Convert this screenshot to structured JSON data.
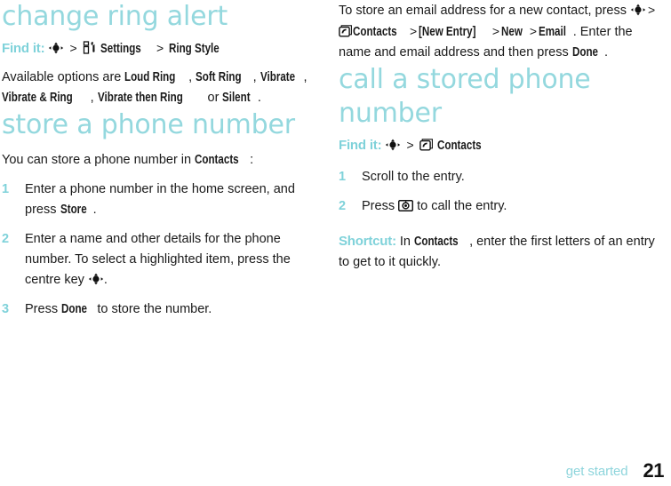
{
  "document": {
    "footer_section": "get started",
    "page_number": "21"
  },
  "colors": {
    "heading_teal": "#94d8de",
    "accent_teal": "#7fd2da",
    "body_text": "#1a1a1a"
  },
  "left_column": {
    "section1": {
      "title": "change ring alert",
      "findit_label": "Find it:",
      "findit_path": [
        {
          "type": "icon",
          "name": "centre-key-icon"
        },
        {
          "type": "sep",
          "text": ">"
        },
        {
          "type": "icon",
          "name": "settings-tools-icon"
        },
        {
          "type": "bold",
          "text": "Settings"
        },
        {
          "type": "sep",
          "text": ">"
        },
        {
          "type": "bold",
          "text": "Ring Style"
        }
      ],
      "paragraph_prefix": "Available options are ",
      "options": [
        "Loud Ring",
        "Soft Ring",
        "Vibrate",
        "Vibrate & Ring",
        "Vibrate then Ring"
      ],
      "options_conjunction": " or ",
      "options_last": "Silent",
      "paragraph_suffix": "."
    },
    "section2": {
      "title": "store a phone number",
      "intro_prefix": "You can store a phone number in ",
      "intro_bold": "Contacts",
      "intro_suffix": ":",
      "steps": [
        {
          "number": "1",
          "parts": [
            {
              "type": "text",
              "text": "Enter a phone number in the home screen, and press "
            },
            {
              "type": "bold",
              "text": "Store"
            },
            {
              "type": "text",
              "text": "."
            }
          ]
        },
        {
          "number": "2",
          "parts": [
            {
              "type": "text",
              "text": "Enter a name and other details for the phone number. To select a highlighted item, press the centre key "
            },
            {
              "type": "icon",
              "name": "centre-key-icon"
            },
            {
              "type": "text",
              "text": "."
            }
          ]
        },
        {
          "number": "3",
          "parts": [
            {
              "type": "text",
              "text": "Press "
            },
            {
              "type": "bold",
              "text": "Done"
            },
            {
              "type": "text",
              "text": " to store the number."
            }
          ]
        }
      ]
    }
  },
  "right_column": {
    "intro": {
      "prefix": "To store an email address for a new contact, press ",
      "path": [
        {
          "type": "icon",
          "name": "centre-key-icon"
        },
        {
          "type": "sep",
          "text": ">"
        },
        {
          "type": "icon",
          "name": "contacts-phone-icon"
        },
        {
          "type": "bold",
          "text": "Contacts"
        },
        {
          "type": "sep",
          "text": ">"
        },
        {
          "type": "bold",
          "text": "[New Entry]"
        },
        {
          "type": "sep",
          "text": ">"
        },
        {
          "type": "bold",
          "text": "New"
        },
        {
          "type": "sep",
          "text": ">"
        },
        {
          "type": "bold",
          "text": "Email"
        }
      ],
      "suffix_before_done": ". Enter the name and email address and then press ",
      "suffix_bold": "Done",
      "suffix_end": "."
    },
    "section": {
      "title": "call a stored phone number",
      "findit_label": "Find it:",
      "findit_path": [
        {
          "type": "icon",
          "name": "centre-key-icon"
        },
        {
          "type": "sep",
          "text": ">"
        },
        {
          "type": "icon",
          "name": "contacts-phone-icon"
        },
        {
          "type": "bold",
          "text": "Contacts"
        }
      ],
      "steps": [
        {
          "number": "1",
          "parts": [
            {
              "type": "text",
              "text": "Scroll to the entry."
            }
          ]
        },
        {
          "number": "2",
          "parts": [
            {
              "type": "text",
              "text": "Press "
            },
            {
              "type": "icon",
              "name": "send-call-key-icon"
            },
            {
              "type": "text",
              "text": " to call the entry."
            }
          ]
        }
      ],
      "shortcut_label": "Shortcut:",
      "shortcut_prefix": " In ",
      "shortcut_bold": "Contacts",
      "shortcut_suffix": ", enter the first letters of an entry to get to it quickly."
    }
  }
}
